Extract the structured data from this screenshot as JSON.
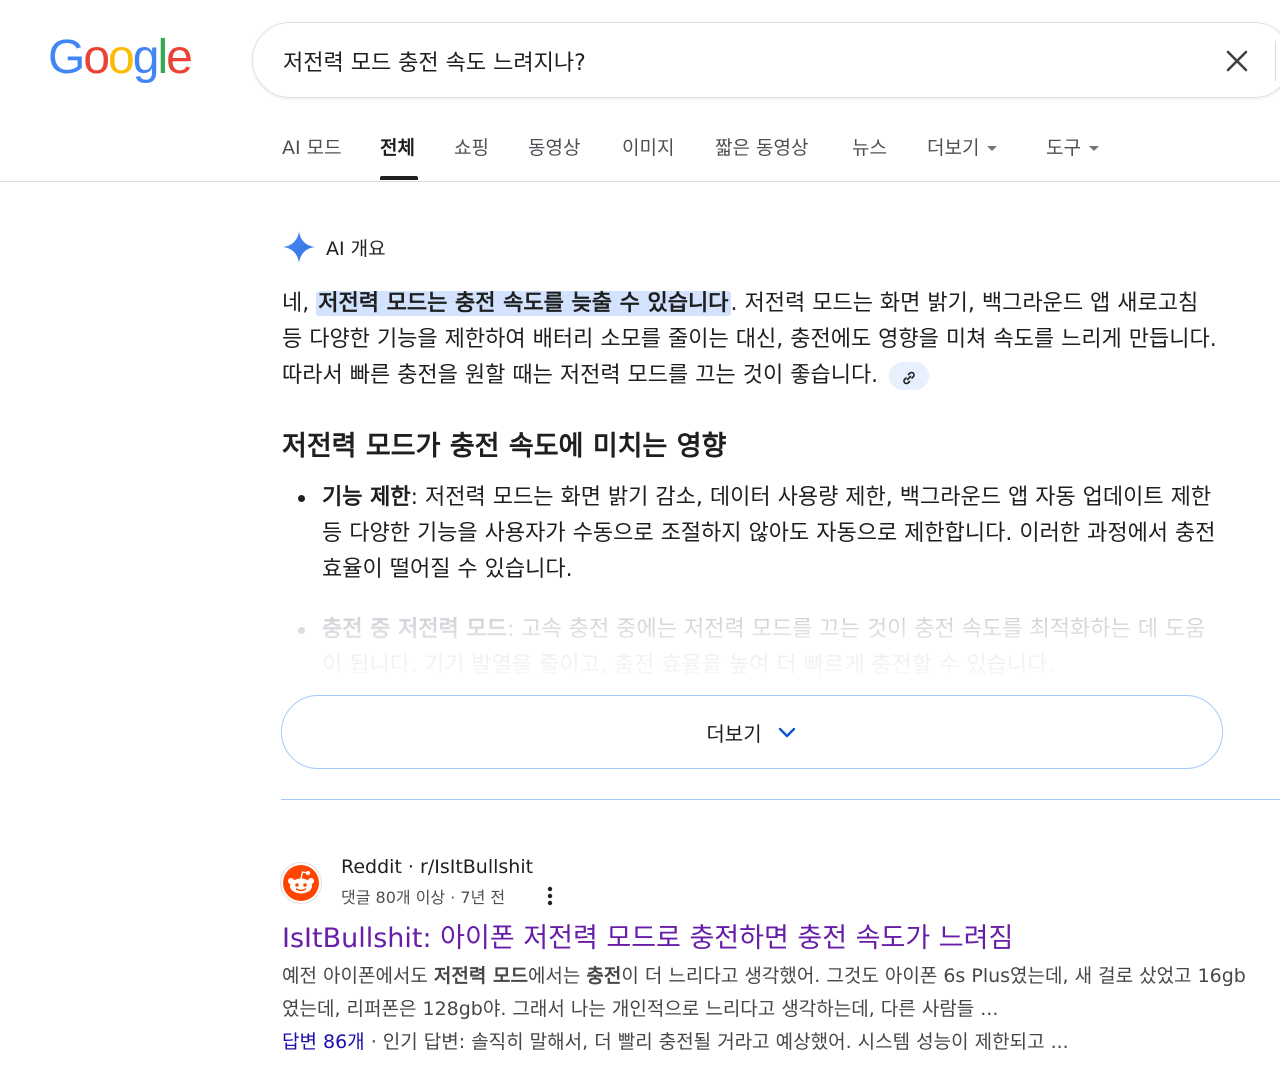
{
  "logo": {
    "letters": [
      "G",
      "o",
      "o",
      "g",
      "l",
      "e"
    ],
    "colors": [
      "#4285F4",
      "#EA4335",
      "#FBBC05",
      "#4285F4",
      "#34A853",
      "#EA4335"
    ]
  },
  "search": {
    "query": "저전력 모드 충전 속도 느려지나?"
  },
  "tabs": [
    {
      "label": "AI 모드"
    },
    {
      "label": "전체"
    },
    {
      "label": "쇼핑"
    },
    {
      "label": "동영상"
    },
    {
      "label": "이미지"
    },
    {
      "label": "짧은 동영상"
    },
    {
      "label": "뉴스"
    },
    {
      "label": "더보기"
    },
    {
      "label": "도구"
    }
  ],
  "ai_overview": {
    "title": "AI 개요",
    "intro_prefix": "네, ",
    "intro_highlight": "저전력 모드는 충전 속도를 늦출 수 있습니다",
    "intro_rest": ". 저전력 모드는 화면 밝기, 백그라운드 앱 새로고침 등 다양한 기능을 제한하여 배터리 소모를 줄이는 대신, 충전에도 영향을 미쳐 속도를 느리게 만듭니다. 따라서 빠른 충전을 원할 때는 저전력 모드를 끄는 것이 좋습니다.",
    "section_heading": "저전력 모드가 충전 속도에 미치는 영향",
    "bullets": [
      {
        "term": "기능 제한",
        "text": ": 저전력 모드는 화면 밝기 감소, 데이터 사용량 제한, 백그라운드 앱 자동 업데이트 제한 등 다양한 기능을 사용자가 수동으로 조절하지 않아도 자동으로 제한합니다. 이러한 과정에서 충전 효율이 떨어질 수 있습니다."
      },
      {
        "term": "충전 중 저전력 모드",
        "text": ": 고속 충전 중에는 저전력 모드를 끄는 것이 충전 속도를 최적화하는 데 도움이 됩니다. 기기 발열을 줄이고, 충전 효율을 높여 더 빠르게 충전할 수 있습니다."
      }
    ],
    "more_label": "더보기"
  },
  "result": {
    "site_name": "Reddit · r/IsItBullshit",
    "meta": "댓글 80개 이상 · 7년 전",
    "title": "IsItBullshit: 아이폰 저전력 모드로 충전하면 충전 속도가 느려짐",
    "snippet_1": "예전 아이폰에서도 ",
    "snippet_b1": "저전력 모드",
    "snippet_2": "에서는 ",
    "snippet_b2": "충전",
    "snippet_3": "이 더 느리다고 생각했어. 그것도 아이폰 6s Plus였는데, 새 걸로 샀었고 16gb였는데, 리퍼폰은 128gb야. 그래서 나는 개인적으로 느리다고 생각하는데, 다른 사람들 ...",
    "answers_link": "답변 86개",
    "answers_text": " · 인기 답변: 솔직히 말해서, 더 빨리 충전될 거라고 예상했어. 시스템 성능이 제한되고 ..."
  }
}
